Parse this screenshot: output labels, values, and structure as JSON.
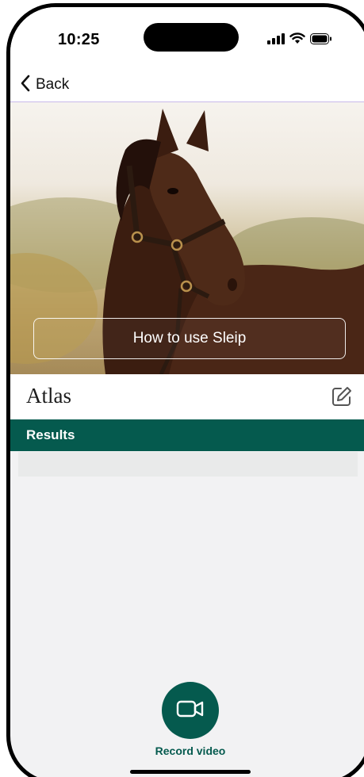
{
  "status_bar": {
    "time": "10:25",
    "icons": [
      "cellular-signal-icon",
      "wifi-icon",
      "battery-icon"
    ]
  },
  "navbar": {
    "back_label": "Back",
    "back_icon": "chevron-left-icon",
    "divider_color": "#c9b9ea"
  },
  "hero": {
    "image_subject": "horse-photo",
    "howto_label": "How to use Sleip"
  },
  "horse": {
    "name": "Atlas",
    "edit_icon": "edit-pencil-icon"
  },
  "results": {
    "label": "Results",
    "rows": [
      ""
    ]
  },
  "record": {
    "label": "Record video",
    "icon": "video-camera-icon"
  },
  "colors": {
    "brand_green": "#055a4e",
    "background": "#f2f2f3",
    "row_background": "#e9eaea"
  }
}
